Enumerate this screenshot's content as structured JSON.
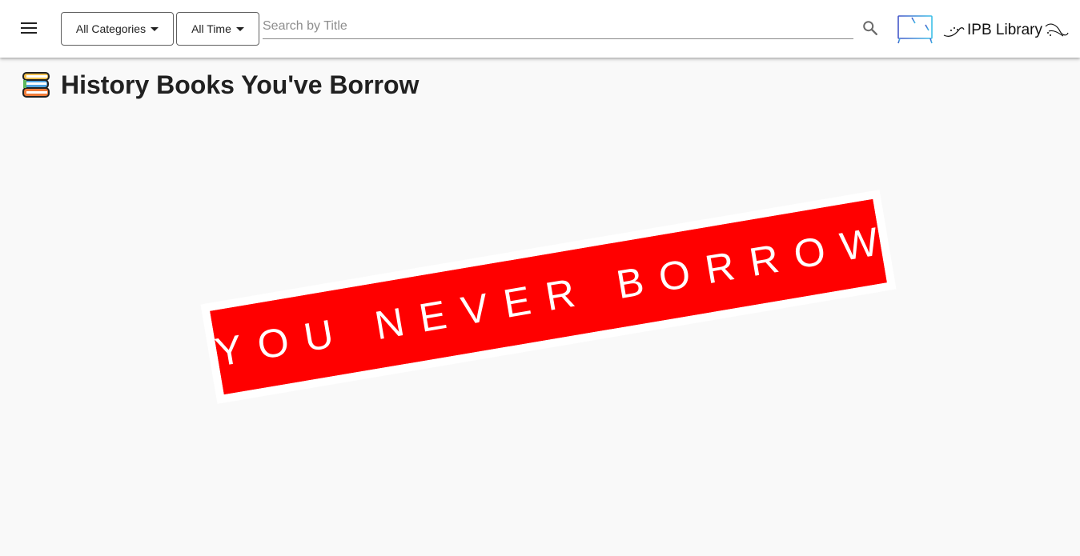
{
  "appbar": {
    "menu_icon": "hamburger-menu-icon",
    "categories_label": "All Categories",
    "time_label": "All Time",
    "search": {
      "placeholder": "Search by Title",
      "value": ""
    },
    "search_icon": "magnifier-icon",
    "brand": {
      "logo_icon": "bookshelf-logo-icon",
      "title": "IPB Library"
    }
  },
  "page": {
    "icon": "stacked-books-icon",
    "title": "History Books You've Borrow"
  },
  "empty_state": {
    "stamp_text": "YOU NEVER BORROW",
    "stamp_color": "#ff0000"
  }
}
